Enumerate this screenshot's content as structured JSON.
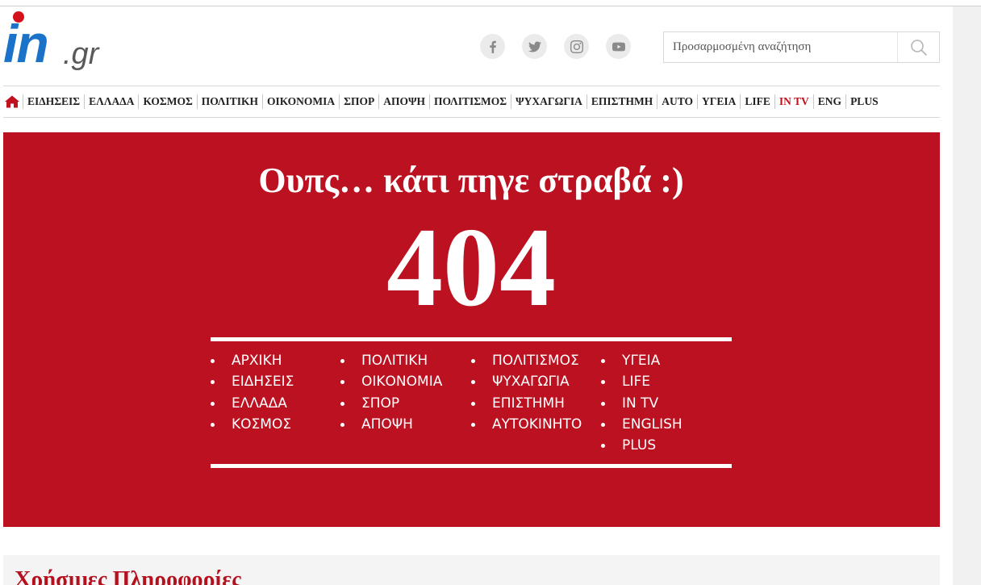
{
  "brand": {
    "in": "in",
    "gr": ".gr"
  },
  "search": {
    "placeholder": "Προσαρμοσμένη αναζήτηση"
  },
  "socials": [
    "facebook-icon",
    "twitter-icon",
    "instagram-icon",
    "youtube-icon"
  ],
  "nav": {
    "items": [
      {
        "label": "ΕΙΔΗΣΕΙΣ"
      },
      {
        "label": "ΕΛΛΑΔΑ"
      },
      {
        "label": "ΚΟΣΜΟΣ"
      },
      {
        "label": "ΠΟΛΙΤΙΚΗ"
      },
      {
        "label": "ΟΙΚΟΝΟΜΙΑ"
      },
      {
        "label": "ΣΠΟΡ"
      },
      {
        "label": "ΑΠΟΨΗ"
      },
      {
        "label": "ΠΟΛΙΤΙΣΜΟΣ"
      },
      {
        "label": "ΨΥΧΑΓΩΓΙΑ"
      },
      {
        "label": "ΕΠΙΣΤΗΜΗ"
      },
      {
        "label": "AUTO"
      },
      {
        "label": "ΥΓΕΙΑ"
      },
      {
        "label": "LIFE"
      },
      {
        "label": "IN TV"
      },
      {
        "label": "ENG"
      },
      {
        "label": "PLUS"
      }
    ]
  },
  "error": {
    "title": "Ουπς… κάτι πηγε στραβά :)",
    "code": "404"
  },
  "links": {
    "col1": [
      "ΑΡΧΙΚΗ",
      "ΕΙΔΗΣΕΙΣ",
      "ΕΛΛΑΔΑ",
      "ΚΟΣΜΟΣ"
    ],
    "col2": [
      "ΠΟΛΙΤΙΚΗ",
      "ΟΙΚΟΝΟΜΙΑ",
      "ΣΠΟΡ",
      "ΑΠΟΨΗ"
    ],
    "col3": [
      "ΠΟΛΙΤΙΣΜΟΣ",
      "ΨΥΧΑΓΩΓΙΑ",
      "ΕΠΙΣΤΗΜΗ",
      "ΑΥΤΟΚΙΝΗΤΟ"
    ],
    "col4": [
      "ΥΓΕΙΑ",
      "LIFE",
      "IN TV",
      "ENGLISH",
      "PLUS"
    ]
  },
  "useful": {
    "heading": "Χρήσιμες Πληροφορίες"
  },
  "colors": {
    "brand_red": "#bb1120",
    "logo_blue": "#1a73c8",
    "intv_red": "#c0111f"
  }
}
